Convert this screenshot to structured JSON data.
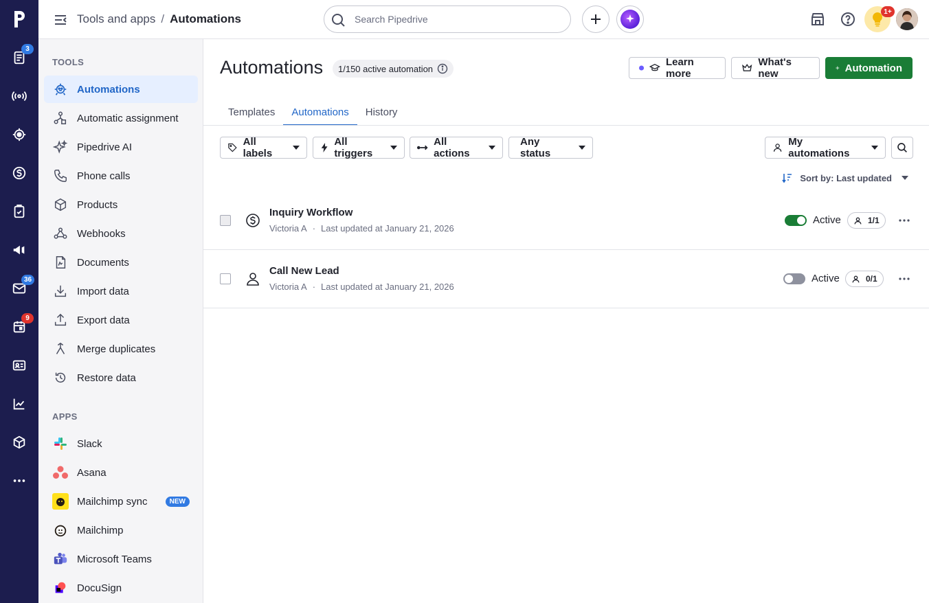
{
  "rail": {
    "badges": {
      "activities_count": "3",
      "mail_count": "36",
      "calendar_count": "9"
    }
  },
  "topbar": {
    "breadcrumb_parent": "Tools and apps",
    "breadcrumb_sep": "/",
    "breadcrumb_current": "Automations",
    "search_placeholder": "Search Pipedrive",
    "notifications_badge": "1+"
  },
  "sidebar": {
    "tools_title": "TOOLS",
    "tools": [
      {
        "label": "Automations",
        "icon": "robot-icon"
      },
      {
        "label": "Automatic assignment",
        "icon": "assignment-icon"
      },
      {
        "label": "Pipedrive AI",
        "icon": "sparkle-icon"
      },
      {
        "label": "Phone calls",
        "icon": "phone-icon"
      },
      {
        "label": "Products",
        "icon": "box-icon"
      },
      {
        "label": "Webhooks",
        "icon": "webhook-icon"
      },
      {
        "label": "Documents",
        "icon": "document-icon"
      },
      {
        "label": "Import data",
        "icon": "download-icon"
      },
      {
        "label": "Export data",
        "icon": "upload-icon"
      },
      {
        "label": "Merge duplicates",
        "icon": "merge-icon"
      },
      {
        "label": "Restore data",
        "icon": "restore-icon"
      }
    ],
    "apps_title": "APPS",
    "apps": [
      {
        "label": "Slack",
        "icon": "slack-icon"
      },
      {
        "label": "Asana",
        "icon": "asana-icon"
      },
      {
        "label": "Mailchimp sync",
        "icon": "mailchimp-sync-icon",
        "badge": "NEW"
      },
      {
        "label": "Mailchimp",
        "icon": "mailchimp-icon"
      },
      {
        "label": "Microsoft Teams",
        "icon": "teams-icon"
      },
      {
        "label": "DocuSign",
        "icon": "docusign-icon"
      }
    ]
  },
  "main": {
    "title": "Automations",
    "active_count": "1/150 active automation",
    "buttons": {
      "learn_more": "Learn more",
      "whats_new": "What's new",
      "add_automation": "Automation"
    },
    "tabs": [
      "Templates",
      "Automations",
      "History"
    ],
    "filters": {
      "labels": "All labels",
      "triggers": "All triggers",
      "actions": "All actions",
      "status": "Any status",
      "owner": "My automations"
    },
    "sort_label": "Sort by: Last updated",
    "rows": [
      {
        "title": "Inquiry Workflow",
        "owner": "Victoria A",
        "dot": "·",
        "updated": "Last updated at January 21, 2026",
        "status": "Active",
        "enabled": true,
        "users": "1/1",
        "icon": "dollar-icon"
      },
      {
        "title": "Call New Lead",
        "owner": "Victoria A",
        "dot": "·",
        "updated": "Last updated at January 21, 2026",
        "status": "Active",
        "enabled": false,
        "users": "0/1",
        "icon": "person-icon"
      }
    ]
  },
  "colors": {
    "rail_bg": "#1c1d4e",
    "accent_blue": "#2166c7",
    "primary_green": "#1a7d36"
  }
}
